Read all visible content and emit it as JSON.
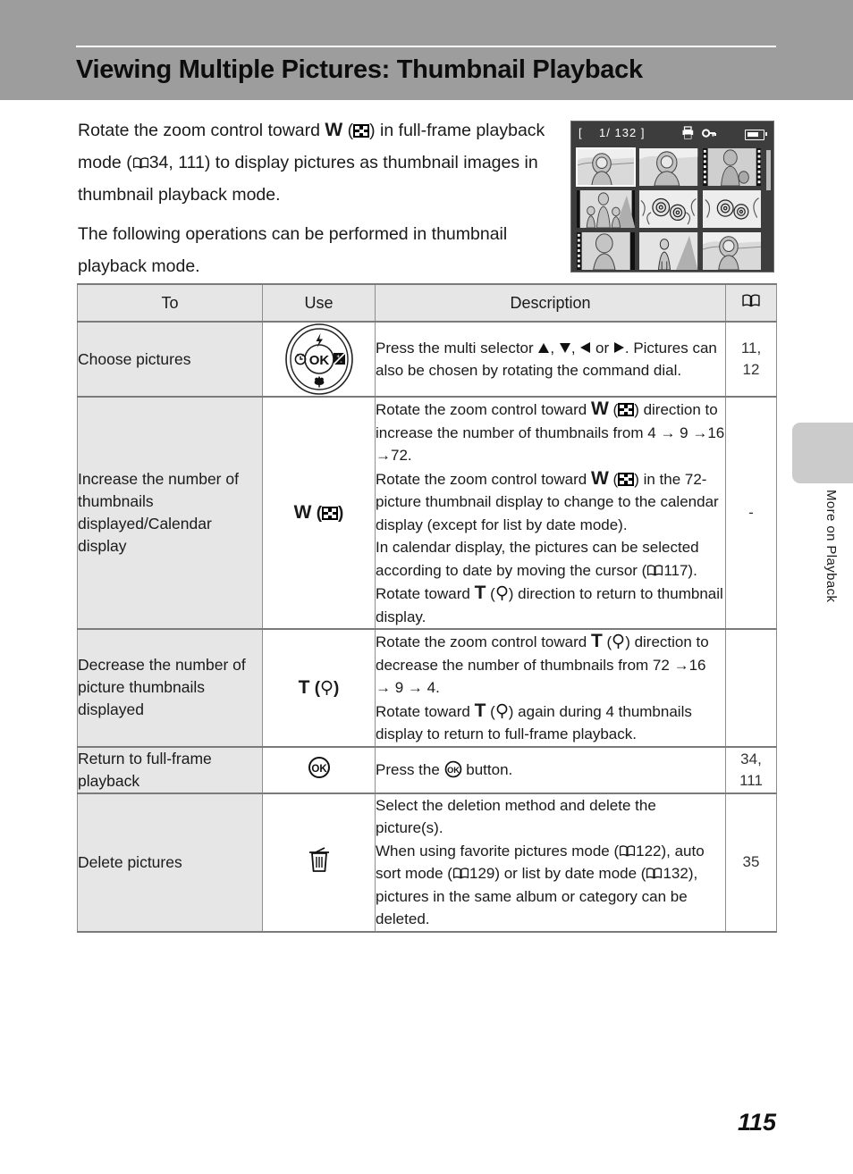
{
  "header": {
    "title": "Viewing Multiple Pictures: Thumbnail Playback"
  },
  "intro": {
    "paragraph1_part1": "Rotate the zoom control toward ",
    "paragraph1_w": "W",
    "paragraph1_part2": ") in full-frame playback mode (",
    "paragraph1_pages": "34, 111",
    "paragraph1_part3": ") to display pictures as thumbnail images in thumbnail playback mode.",
    "paragraph2": "The following operations can be performed in thumbnail playback mode."
  },
  "lcd": {
    "counter": "[    1/ 132 ]",
    "print_icon": "print-icon",
    "protect_icon": "key-protect-icon",
    "battery_icon": "battery-icon",
    "thumbnail_count": 9,
    "selected_index": 0
  },
  "table": {
    "headers": {
      "to": "To",
      "use": "Use",
      "description": "Description",
      "reference": "book-icon"
    },
    "rows": [
      {
        "to": "Choose pictures",
        "use_icon": "multi-selector-dial",
        "use_label": "",
        "desc_line1_a": "Press the multi selector ",
        "desc_line1_b": ", ",
        "desc_line1_c": ", ",
        "desc_line1_d": " or ",
        "desc_line1_e": ". Pictures can also be chosen by rotating the command dial.",
        "reference": "11,\n12"
      },
      {
        "to": "Increase the number of thumbnails displayed/Calendar display",
        "use_icon": "zoom-wide-thumbnail-icon",
        "use_label": "W",
        "desc_a": "Rotate the zoom control toward ",
        "desc_b": ") direction to increase the number of thumbnails from 4 ",
        "desc_c": " 9 ",
        "desc_d": "16 ",
        "desc_e": "72.",
        "desc_f": "Rotate the zoom control toward ",
        "desc_g": ") in the 72-picture thumbnail display to change to the calendar display (except for list by date mode).",
        "desc_h": "In calendar display, the pictures can be selected according to date by moving the cursor (",
        "desc_i": "117).",
        "desc_j": "Rotate toward ",
        "desc_k": "T",
        "desc_l": ") direction to return to thumbnail display.",
        "reference": "-"
      },
      {
        "to": "Decrease the number of picture thumbnails displayed",
        "use_icon": "zoom-tele-magnifier-icon",
        "use_label": "T",
        "desc_a": "Rotate the zoom control toward ",
        "desc_b": ") direction to decrease the number of thumbnails from 72 ",
        "desc_c": "16 ",
        "desc_d": " 9 ",
        "desc_e": " 4.",
        "desc_f": "Rotate toward ",
        "desc_g": ") again during 4 thumbnails display to return to full-frame playback.",
        "reference": ""
      },
      {
        "to": "Return to full-frame playback",
        "use_icon": "ok-button-icon",
        "use_label": "",
        "desc_a": "Press the ",
        "desc_b": " button.",
        "reference": "34,\n111"
      },
      {
        "to": "Delete pictures",
        "use_icon": "trash-delete-icon",
        "use_label": "",
        "desc_a": "Select the deletion method and delete the picture(s).",
        "desc_b": "When using favorite pictures mode (",
        "desc_c": "122), auto sort mode (",
        "desc_d": "129) or list by date mode (",
        "desc_e": "132), pictures in the same album or category can be deleted.",
        "reference": "35"
      }
    ]
  },
  "side_tab": {
    "label": "More on Playback"
  },
  "footer": {
    "page_number": "115"
  },
  "colors": {
    "header_band": "#9d9d9d",
    "table_header_bg": "#e6e6e6",
    "first_col_bg": "#e6e6e6",
    "side_tab": "#cbcbcb",
    "lcd_bg": "#3d3d3d"
  }
}
